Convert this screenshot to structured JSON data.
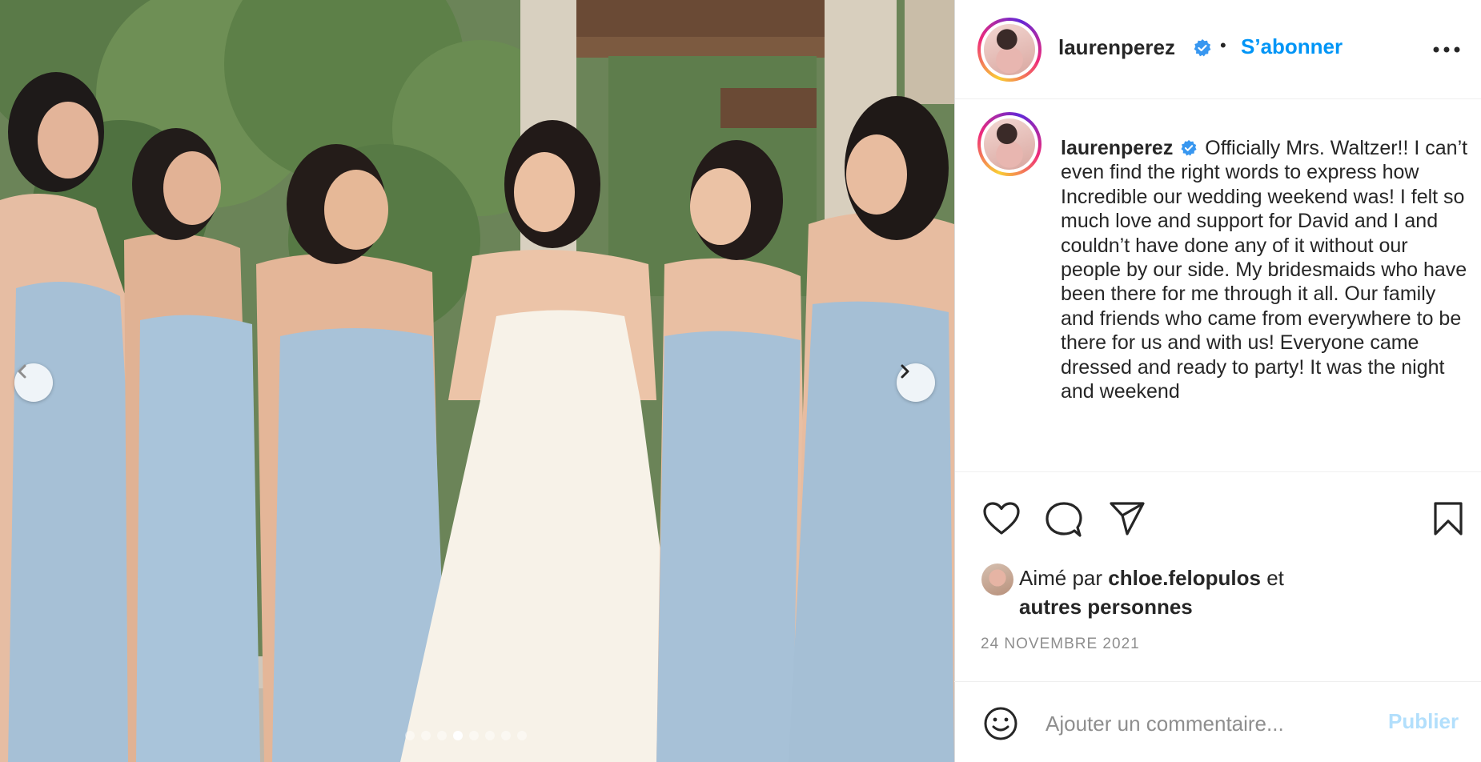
{
  "post": {
    "username": "laurenperez",
    "verified": true,
    "follow_label": "S’abonner",
    "separator": "•",
    "more_icon": "more-horizontal-icon",
    "caption": "Officially Mrs. Waltzer!! I can’t even find the right words to express how Incredible our wedding weekend was! I felt so much love and support for David and I and couldn’t have done any of it without our people by our side. My bridesmaids who have been there for me through it all. Our family and friends who came from everywhere to be there for us and with us! Everyone came dressed and ready to party! It was the night and weekend",
    "carousel": {
      "total": 8,
      "active_index": 3,
      "prev_icon": "chevron-left-icon",
      "next_icon": "chevron-right-icon"
    }
  },
  "actions": {
    "like_icon": "heart-icon",
    "comment_icon": "comment-icon",
    "share_icon": "paper-plane-icon",
    "save_icon": "bookmark-icon"
  },
  "likes": {
    "prefix": "Aimé par",
    "user": "chloe.felopulos",
    "middle": "et",
    "others": "autres personnes"
  },
  "date": "24 NOVEMBRE 2021",
  "comment": {
    "placeholder": "Ajouter un commentaire...",
    "publish_label": "Publier",
    "emoji_icon": "smiley-icon"
  },
  "colors": {
    "accent": "#0095f6",
    "publish_disabled": "#b2dffc",
    "verified": "#3897f0",
    "dress_blue": "#a9c3d8"
  }
}
